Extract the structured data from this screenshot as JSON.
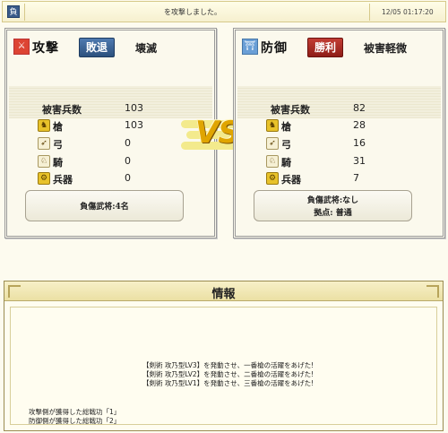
{
  "topbar": {
    "icon_char": "負",
    "message": "を攻撃しました。",
    "timestamp": "12/05 01:17:20"
  },
  "attacker": {
    "role": "攻撃",
    "result": "敗退",
    "outcome": "壊滅",
    "total_label": "被害兵数",
    "total_value": "103",
    "units": [
      {
        "name": "槍",
        "value": "103"
      },
      {
        "name": "弓",
        "value": "0"
      },
      {
        "name": "騎",
        "value": "0"
      },
      {
        "name": "兵器",
        "value": "0"
      }
    ],
    "info_line1": "負傷武将:4名"
  },
  "defender": {
    "role": "防御",
    "result": "勝利",
    "outcome": "被害軽微",
    "total_label": "被害兵数",
    "total_value": "82",
    "units": [
      {
        "name": "槍",
        "value": "28"
      },
      {
        "name": "弓",
        "value": "16"
      },
      {
        "name": "騎",
        "value": "31"
      },
      {
        "name": "兵器",
        "value": "7"
      }
    ],
    "info_line1": "負傷武将:なし",
    "info_line2": "拠点: 普通"
  },
  "vs_text": "VS",
  "info": {
    "title": "情報",
    "messages": [
      "【剣術 攻乃型LV3】を発動させ、一番槍の活躍をあげた!",
      "【剣術 攻乃型LV2】を発動させ、二番槍の活躍をあげた!",
      "【剣術 攻乃型LV1】を発動させ、三番槍の活躍をあげた!"
    ],
    "merits": [
      "攻撃側が獲得した総戦功「1」",
      "防御側が獲得した総戦功「2」"
    ]
  }
}
